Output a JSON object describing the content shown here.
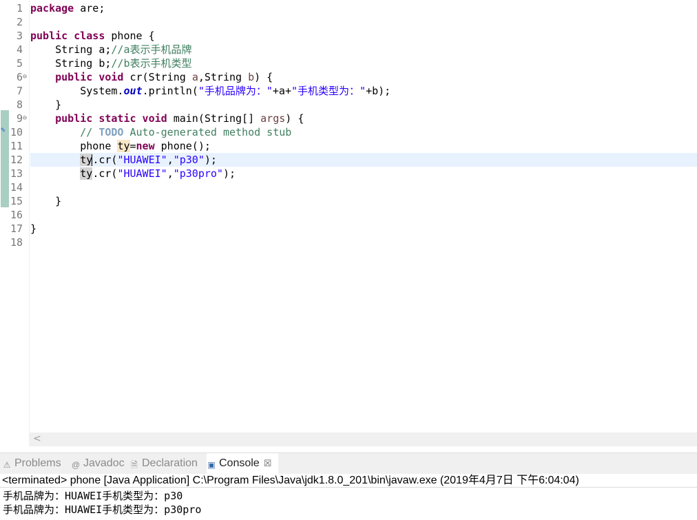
{
  "editor": {
    "lines": [
      {
        "n": "1",
        "segs": [
          {
            "t": "package",
            "c": "kw"
          },
          {
            "t": " are;",
            "c": ""
          }
        ]
      },
      {
        "n": "2",
        "segs": []
      },
      {
        "n": "3",
        "segs": [
          {
            "t": "public class",
            "c": "kw"
          },
          {
            "t": " phone {",
            "c": ""
          }
        ]
      },
      {
        "n": "4",
        "segs": [
          {
            "t": "    String a;",
            "c": ""
          },
          {
            "t": "//a表示手机品牌",
            "c": "cmt"
          }
        ]
      },
      {
        "n": "5",
        "segs": [
          {
            "t": "    String b;",
            "c": ""
          },
          {
            "t": "//b表示手机类型",
            "c": "cmt"
          }
        ]
      },
      {
        "n": "6",
        "fold": "⊖",
        "segs": [
          {
            "t": "    ",
            "c": ""
          },
          {
            "t": "public void",
            "c": "kw"
          },
          {
            "t": " cr(String ",
            "c": ""
          },
          {
            "t": "a",
            "c": "param"
          },
          {
            "t": ",String ",
            "c": ""
          },
          {
            "t": "b",
            "c": "param"
          },
          {
            "t": ") {",
            "c": ""
          }
        ]
      },
      {
        "n": "7",
        "segs": [
          {
            "t": "        System.",
            "c": ""
          },
          {
            "t": "out",
            "c": "fld"
          },
          {
            "t": ".println(",
            "c": ""
          },
          {
            "t": "\"手机品牌为：\"",
            "c": "str"
          },
          {
            "t": "+a+",
            "c": ""
          },
          {
            "t": "\"手机类型为：\"",
            "c": "str"
          },
          {
            "t": "+b);",
            "c": ""
          }
        ]
      },
      {
        "n": "8",
        "segs": [
          {
            "t": "    }",
            "c": ""
          }
        ]
      },
      {
        "n": "9",
        "fold": "⊖",
        "segs": [
          {
            "t": "    ",
            "c": ""
          },
          {
            "t": "public static void",
            "c": "kw"
          },
          {
            "t": " main(String[] ",
            "c": ""
          },
          {
            "t": "args",
            "c": "param"
          },
          {
            "t": ") {",
            "c": ""
          }
        ]
      },
      {
        "n": "10",
        "segs": [
          {
            "t": "        // ",
            "c": "cmt"
          },
          {
            "t": "TODO",
            "c": "todo"
          },
          {
            "t": " Auto-generated method stub",
            "c": "cmt"
          }
        ]
      },
      {
        "n": "11",
        "segs": [
          {
            "t": "        phone ",
            "c": ""
          },
          {
            "t": "ty",
            "c": "hl-w"
          },
          {
            "t": "=",
            "c": ""
          },
          {
            "t": "new",
            "c": "kw"
          },
          {
            "t": " phone();",
            "c": ""
          }
        ]
      },
      {
        "n": "12",
        "current": true,
        "segs": [
          {
            "t": "        ",
            "c": ""
          },
          {
            "t": "ty",
            "c": "hl-r"
          },
          {
            "t": "",
            "c": "caret"
          },
          {
            "t": ".cr(",
            "c": ""
          },
          {
            "t": "\"HUAWEI\"",
            "c": "str"
          },
          {
            "t": ",",
            "c": ""
          },
          {
            "t": "\"p30\"",
            "c": "str"
          },
          {
            "t": ");",
            "c": ""
          }
        ]
      },
      {
        "n": "13",
        "segs": [
          {
            "t": "        ",
            "c": ""
          },
          {
            "t": "ty",
            "c": "hl-r"
          },
          {
            "t": ".cr(",
            "c": ""
          },
          {
            "t": "\"HUAWEI\"",
            "c": "str"
          },
          {
            "t": ",",
            "c": ""
          },
          {
            "t": "\"p30pro\"",
            "c": "str"
          },
          {
            "t": ");",
            "c": ""
          }
        ]
      },
      {
        "n": "14",
        "segs": []
      },
      {
        "n": "15",
        "segs": [
          {
            "t": "    }",
            "c": ""
          }
        ]
      },
      {
        "n": "16",
        "segs": []
      },
      {
        "n": "17",
        "segs": [
          {
            "t": "}",
            "c": ""
          }
        ]
      },
      {
        "n": "18",
        "segs": []
      }
    ]
  },
  "hscroll": {
    "arrow": "<"
  },
  "tabs": [
    {
      "name": "problems",
      "label": "Problems",
      "icon": "⚠",
      "icon_name": "problems-icon",
      "color": "#8a8a8a"
    },
    {
      "name": "javadoc",
      "label": "Javadoc",
      "icon": "@",
      "icon_name": "javadoc-icon",
      "color": "#8a8a8a"
    },
    {
      "name": "declaration",
      "label": "Declaration",
      "icon": "🗎",
      "icon_name": "declaration-icon",
      "color": "#8a8a8a"
    },
    {
      "name": "console",
      "label": "Console",
      "icon": "▣",
      "icon_name": "console-icon",
      "active": true,
      "close": "☒"
    }
  ],
  "console": {
    "header": "<terminated> phone [Java Application] C:\\Program Files\\Java\\jdk1.8.0_201\\bin\\javaw.exe (2019年4月7日 下午6:04:04)",
    "output": [
      "手机品牌为：HUAWEI手机类型为：p30",
      "手机品牌为：HUAWEI手机类型为：p30pro"
    ]
  },
  "colors": {
    "keyword": "#7f0055",
    "string": "#2a00ff",
    "comment": "#3f7f5f",
    "current_line": "#e8f2fe"
  }
}
